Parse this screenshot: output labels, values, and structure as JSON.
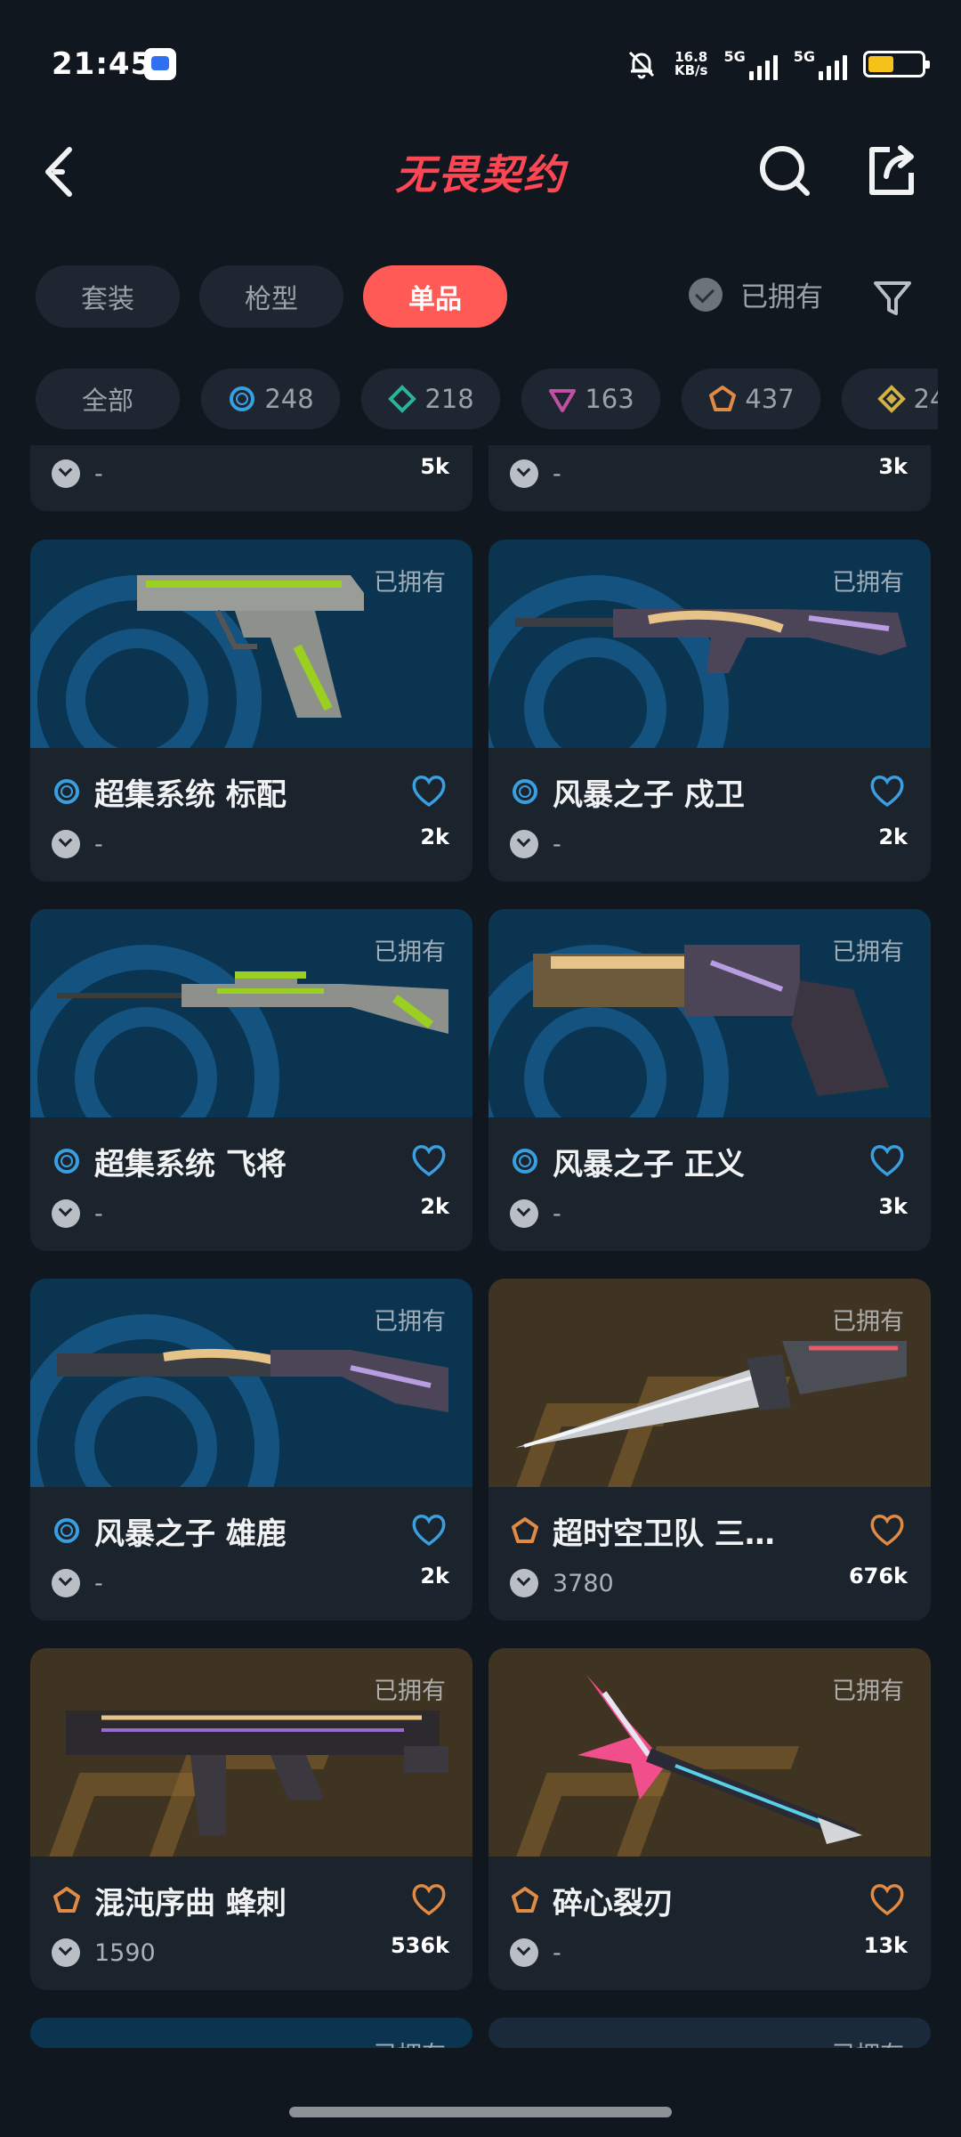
{
  "status_bar": {
    "time": "21:45",
    "speed_value": "16.8",
    "speed_unit": "KB/s",
    "net1": "5G",
    "net2": "5G"
  },
  "header": {
    "title": "无畏契约"
  },
  "tabs": [
    {
      "label": "套装",
      "active": false
    },
    {
      "label": "枪型",
      "active": false
    },
    {
      "label": "单品",
      "active": true
    }
  ],
  "owned_filter_label": "已拥有",
  "chips": [
    {
      "label": "全部",
      "icon": ""
    },
    {
      "label": "248",
      "icon": "tier-select-icon",
      "color": "#3a9fe0"
    },
    {
      "label": "218",
      "icon": "tier-deluxe-icon",
      "color": "#2bb39b"
    },
    {
      "label": "163",
      "icon": "tier-premium-icon",
      "color": "#c14fa4"
    },
    {
      "label": "437",
      "icon": "tier-exclusive-icon",
      "color": "#e08a43"
    },
    {
      "label": "24",
      "icon": "tier-ultra-icon",
      "color": "#d3b144"
    }
  ],
  "top_partial_cards": [
    {
      "price": "-",
      "count": "5k"
    },
    {
      "price": "-",
      "count": "3k"
    }
  ],
  "cards": [
    {
      "name": "超集系统 标配",
      "owned": "已拥有",
      "price": "-",
      "count": "2k",
      "tier": "select",
      "tier_color": "#3a9fe0",
      "bg": "blue"
    },
    {
      "name": "风暴之子 戍卫",
      "owned": "已拥有",
      "price": "-",
      "count": "2k",
      "tier": "select",
      "tier_color": "#3a9fe0",
      "bg": "blue"
    },
    {
      "name": "超集系统 飞将",
      "owned": "已拥有",
      "price": "-",
      "count": "2k",
      "tier": "select",
      "tier_color": "#3a9fe0",
      "bg": "blue"
    },
    {
      "name": "风暴之子 正义",
      "owned": "已拥有",
      "price": "-",
      "count": "3k",
      "tier": "select",
      "tier_color": "#3a9fe0",
      "bg": "blue"
    },
    {
      "name": "风暴之子 雄鹿",
      "owned": "已拥有",
      "price": "-",
      "count": "2k",
      "tier": "select",
      "tier_color": "#3a9fe0",
      "bg": "blue"
    },
    {
      "name": "超时空卫队 三…",
      "owned": "已拥有",
      "price": "3780",
      "count": "676k",
      "tier": "exclusive",
      "tier_color": "#e08a43",
      "bg": "gold"
    },
    {
      "name": "混沌序曲 蜂刺",
      "owned": "已拥有",
      "price": "1590",
      "count": "536k",
      "tier": "exclusive",
      "tier_color": "#e08a43",
      "bg": "gold"
    },
    {
      "name": "碎心裂刃",
      "owned": "已拥有",
      "price": "-",
      "count": "13k",
      "tier": "exclusive",
      "tier_color": "#e08a43",
      "bg": "gold"
    }
  ],
  "bottom_partial_owned": [
    "已拥有",
    "已拥有"
  ]
}
